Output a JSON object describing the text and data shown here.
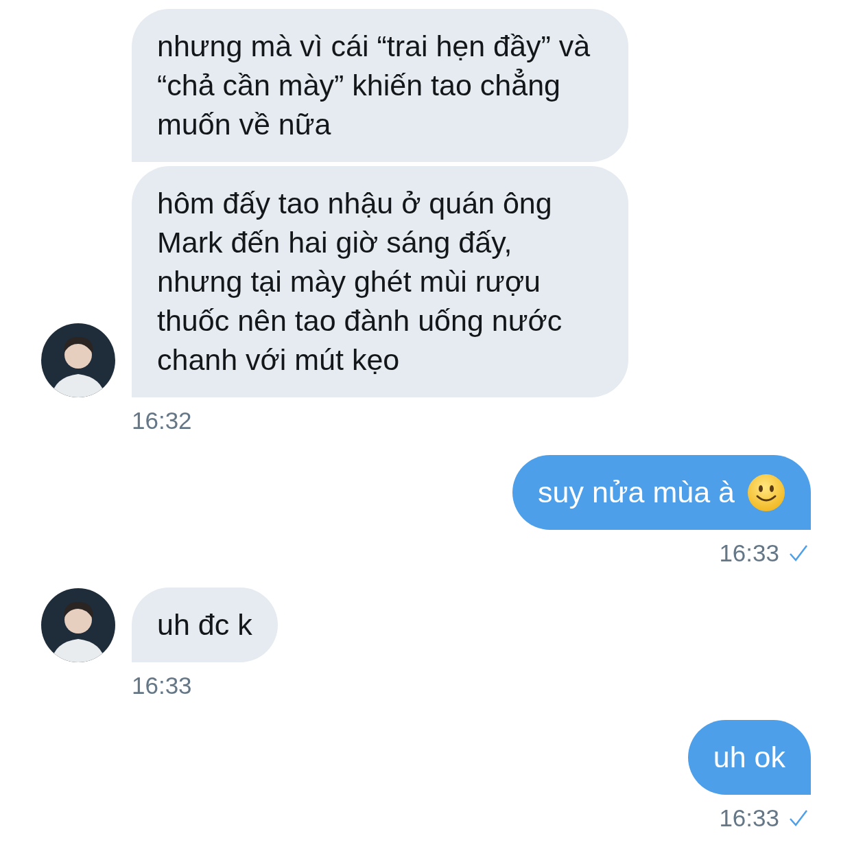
{
  "messages": [
    {
      "kind": "received",
      "avatar": true,
      "bubbles": [
        {
          "text": "nhưng mà vì cái “trai hẹn đầy” và “chả cần mày” khiến tao chẳng muốn về nữa"
        },
        {
          "text": "hôm đấy tao nhậu ở quán ông Mark đến hai giờ sáng đấy, nhưng tại mày ghét mùi rượu thuốc nên tao đành uống nước chanh với mút kẹo"
        }
      ],
      "time": "16:32"
    },
    {
      "kind": "sent",
      "bubbles": [
        {
          "text": "suy nửa mùa à",
          "emoji": true
        }
      ],
      "time": "16:33",
      "read": true
    },
    {
      "kind": "received",
      "avatar": true,
      "bubbles": [
        {
          "text": "uh đc k"
        }
      ],
      "time": "16:33"
    },
    {
      "kind": "sent",
      "bubbles": [
        {
          "text": "uh ok"
        }
      ],
      "time": "16:33",
      "read": true
    }
  ]
}
